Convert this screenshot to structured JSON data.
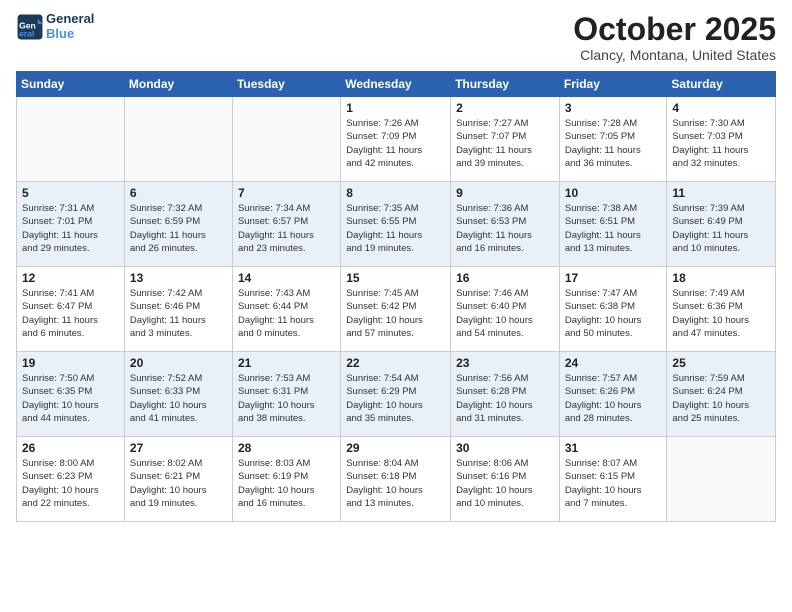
{
  "header": {
    "logo_line1": "General",
    "logo_line2": "Blue",
    "month": "October 2025",
    "location": "Clancy, Montana, United States"
  },
  "weekdays": [
    "Sunday",
    "Monday",
    "Tuesday",
    "Wednesday",
    "Thursday",
    "Friday",
    "Saturday"
  ],
  "weeks": [
    [
      {
        "day": "",
        "info": ""
      },
      {
        "day": "",
        "info": ""
      },
      {
        "day": "",
        "info": ""
      },
      {
        "day": "1",
        "info": "Sunrise: 7:26 AM\nSunset: 7:09 PM\nDaylight: 11 hours\nand 42 minutes."
      },
      {
        "day": "2",
        "info": "Sunrise: 7:27 AM\nSunset: 7:07 PM\nDaylight: 11 hours\nand 39 minutes."
      },
      {
        "day": "3",
        "info": "Sunrise: 7:28 AM\nSunset: 7:05 PM\nDaylight: 11 hours\nand 36 minutes."
      },
      {
        "day": "4",
        "info": "Sunrise: 7:30 AM\nSunset: 7:03 PM\nDaylight: 11 hours\nand 32 minutes."
      }
    ],
    [
      {
        "day": "5",
        "info": "Sunrise: 7:31 AM\nSunset: 7:01 PM\nDaylight: 11 hours\nand 29 minutes."
      },
      {
        "day": "6",
        "info": "Sunrise: 7:32 AM\nSunset: 6:59 PM\nDaylight: 11 hours\nand 26 minutes."
      },
      {
        "day": "7",
        "info": "Sunrise: 7:34 AM\nSunset: 6:57 PM\nDaylight: 11 hours\nand 23 minutes."
      },
      {
        "day": "8",
        "info": "Sunrise: 7:35 AM\nSunset: 6:55 PM\nDaylight: 11 hours\nand 19 minutes."
      },
      {
        "day": "9",
        "info": "Sunrise: 7:36 AM\nSunset: 6:53 PM\nDaylight: 11 hours\nand 16 minutes."
      },
      {
        "day": "10",
        "info": "Sunrise: 7:38 AM\nSunset: 6:51 PM\nDaylight: 11 hours\nand 13 minutes."
      },
      {
        "day": "11",
        "info": "Sunrise: 7:39 AM\nSunset: 6:49 PM\nDaylight: 11 hours\nand 10 minutes."
      }
    ],
    [
      {
        "day": "12",
        "info": "Sunrise: 7:41 AM\nSunset: 6:47 PM\nDaylight: 11 hours\nand 6 minutes."
      },
      {
        "day": "13",
        "info": "Sunrise: 7:42 AM\nSunset: 6:46 PM\nDaylight: 11 hours\nand 3 minutes."
      },
      {
        "day": "14",
        "info": "Sunrise: 7:43 AM\nSunset: 6:44 PM\nDaylight: 11 hours\nand 0 minutes."
      },
      {
        "day": "15",
        "info": "Sunrise: 7:45 AM\nSunset: 6:42 PM\nDaylight: 10 hours\nand 57 minutes."
      },
      {
        "day": "16",
        "info": "Sunrise: 7:46 AM\nSunset: 6:40 PM\nDaylight: 10 hours\nand 54 minutes."
      },
      {
        "day": "17",
        "info": "Sunrise: 7:47 AM\nSunset: 6:38 PM\nDaylight: 10 hours\nand 50 minutes."
      },
      {
        "day": "18",
        "info": "Sunrise: 7:49 AM\nSunset: 6:36 PM\nDaylight: 10 hours\nand 47 minutes."
      }
    ],
    [
      {
        "day": "19",
        "info": "Sunrise: 7:50 AM\nSunset: 6:35 PM\nDaylight: 10 hours\nand 44 minutes."
      },
      {
        "day": "20",
        "info": "Sunrise: 7:52 AM\nSunset: 6:33 PM\nDaylight: 10 hours\nand 41 minutes."
      },
      {
        "day": "21",
        "info": "Sunrise: 7:53 AM\nSunset: 6:31 PM\nDaylight: 10 hours\nand 38 minutes."
      },
      {
        "day": "22",
        "info": "Sunrise: 7:54 AM\nSunset: 6:29 PM\nDaylight: 10 hours\nand 35 minutes."
      },
      {
        "day": "23",
        "info": "Sunrise: 7:56 AM\nSunset: 6:28 PM\nDaylight: 10 hours\nand 31 minutes."
      },
      {
        "day": "24",
        "info": "Sunrise: 7:57 AM\nSunset: 6:26 PM\nDaylight: 10 hours\nand 28 minutes."
      },
      {
        "day": "25",
        "info": "Sunrise: 7:59 AM\nSunset: 6:24 PM\nDaylight: 10 hours\nand 25 minutes."
      }
    ],
    [
      {
        "day": "26",
        "info": "Sunrise: 8:00 AM\nSunset: 6:23 PM\nDaylight: 10 hours\nand 22 minutes."
      },
      {
        "day": "27",
        "info": "Sunrise: 8:02 AM\nSunset: 6:21 PM\nDaylight: 10 hours\nand 19 minutes."
      },
      {
        "day": "28",
        "info": "Sunrise: 8:03 AM\nSunset: 6:19 PM\nDaylight: 10 hours\nand 16 minutes."
      },
      {
        "day": "29",
        "info": "Sunrise: 8:04 AM\nSunset: 6:18 PM\nDaylight: 10 hours\nand 13 minutes."
      },
      {
        "day": "30",
        "info": "Sunrise: 8:06 AM\nSunset: 6:16 PM\nDaylight: 10 hours\nand 10 minutes."
      },
      {
        "day": "31",
        "info": "Sunrise: 8:07 AM\nSunset: 6:15 PM\nDaylight: 10 hours\nand 7 minutes."
      },
      {
        "day": "",
        "info": ""
      }
    ]
  ]
}
